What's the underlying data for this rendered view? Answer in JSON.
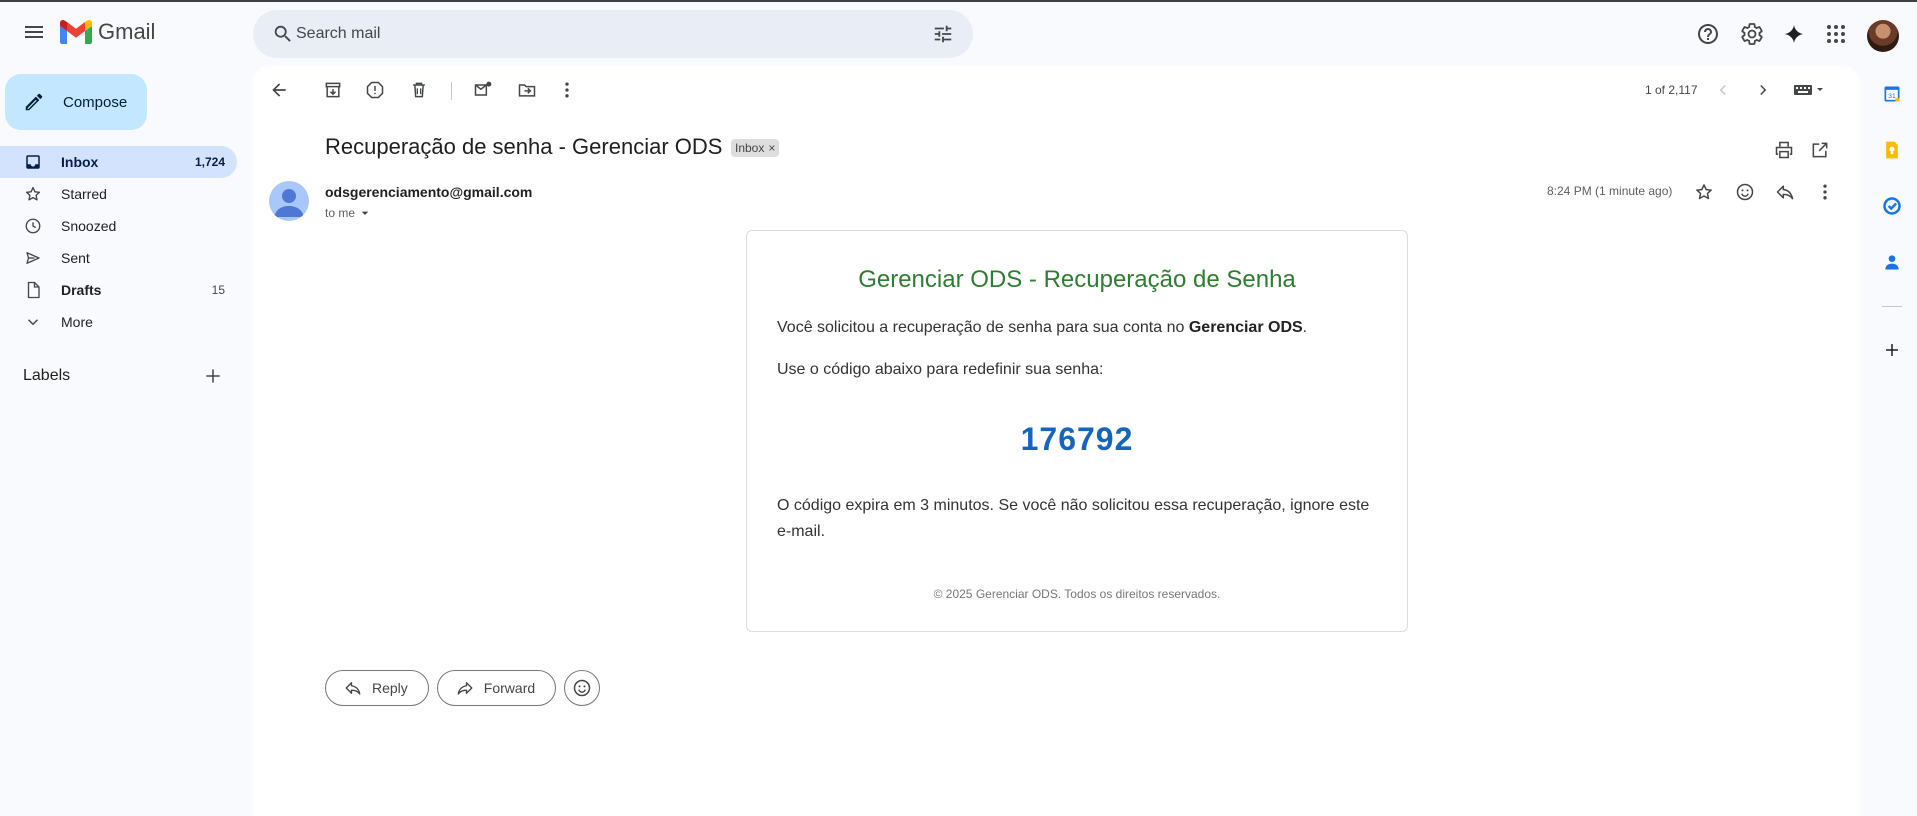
{
  "app": {
    "name": "Gmail"
  },
  "search": {
    "placeholder": "Search mail"
  },
  "compose": {
    "label": "Compose"
  },
  "nav": {
    "items": [
      {
        "label": "Inbox",
        "count": "1,724"
      },
      {
        "label": "Starred",
        "count": ""
      },
      {
        "label": "Snoozed",
        "count": ""
      },
      {
        "label": "Sent",
        "count": ""
      },
      {
        "label": "Drafts",
        "count": "15"
      },
      {
        "label": "More",
        "count": ""
      }
    ],
    "labels_heading": "Labels"
  },
  "toolbar": {
    "pager": "1 of 2,117"
  },
  "email": {
    "subject": "Recuperação de senha - Gerenciar ODS",
    "chip": "Inbox",
    "chip_close": "×",
    "sender": "odsgerenciamento@gmail.com",
    "to": "to me",
    "time": "8:24 PM (1 minute ago)",
    "body": {
      "title": "Gerenciar ODS - Recuperação de Senha",
      "p1_prefix": "Você solicitou a recuperação de senha para sua conta no ",
      "p1_bold": "Gerenciar ODS",
      "p1_suffix": ".",
      "p2": "Use o código abaixo para redefinir sua senha:",
      "code": "176792",
      "p3": "O código expira em 3 minutos. Se você não solicitou essa recuperação, ignore este e-mail.",
      "footer": "© 2025 Gerenciar ODS. Todos os direitos reservados."
    }
  },
  "actions": {
    "reply": "Reply",
    "forward": "Forward"
  },
  "colors": {
    "accent": "#c2e7ff",
    "active_nav": "#d3e3fd",
    "title_green": "#2e7d32",
    "code_blue": "#1565c0"
  }
}
